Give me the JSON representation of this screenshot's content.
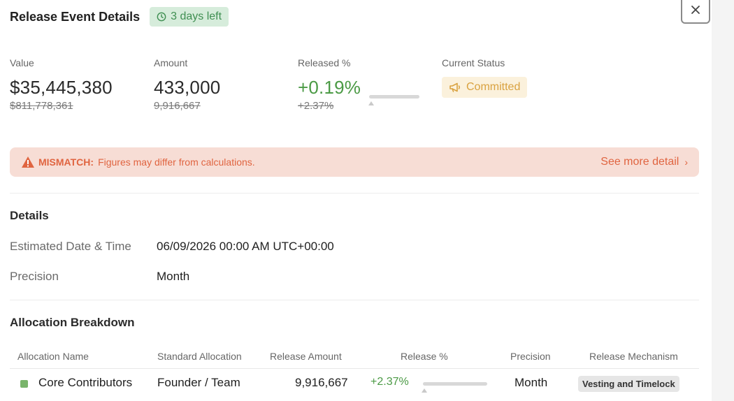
{
  "header": {
    "title": "Release Event Details",
    "days_left": "3 days left"
  },
  "stats": {
    "value": {
      "label": "Value",
      "current": "$35,445,380",
      "previous": "$811,778,361"
    },
    "amount": {
      "label": "Amount",
      "current": "433,000",
      "previous": "9,916,667"
    },
    "released": {
      "label": "Released %",
      "current": "+0.19%",
      "previous": "+2.37%",
      "fraction": 0.0019
    },
    "status": {
      "label": "Current Status",
      "value": "Committed"
    }
  },
  "alert": {
    "strong": "MISMATCH:",
    "text": "Figures may differ from calculations.",
    "link": "See more detail"
  },
  "details": {
    "title": "Details",
    "rows": [
      {
        "label": "Estimated Date & Time",
        "value": "06/09/2026 00:00 AM UTC+00:00"
      },
      {
        "label": "Precision",
        "value": "Month"
      }
    ]
  },
  "allocation": {
    "title": "Allocation Breakdown",
    "columns": [
      "Allocation Name",
      "Standard Allocation",
      "Release Amount",
      "Release %",
      "Precision",
      "Release Mechanism"
    ],
    "rows": [
      {
        "name": "Core Contributors",
        "standard": "Founder / Team",
        "amount": "9,916,667",
        "pct": "+2.37%",
        "pct_fraction": 0.0237,
        "precision": "Month",
        "mechanism": "Vesting and Timelock"
      }
    ]
  },
  "colors": {
    "green": "#4b9a45",
    "amber": "#d9a240",
    "alert": "#e06440",
    "alert_bg": "#f7ddd5",
    "dot": "#79b46b"
  },
  "icons": {
    "clock": "clock-icon",
    "close": "close-icon",
    "status": "megaphone-icon",
    "alert": "warning-triangle-icon",
    "chevron": "chevron-right-icon"
  }
}
